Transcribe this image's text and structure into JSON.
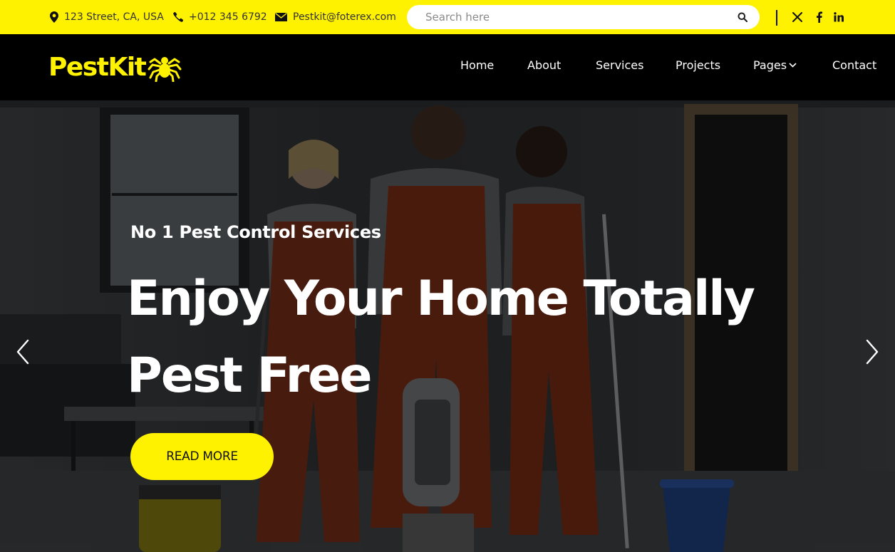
{
  "topbar": {
    "address": "123 Street, CA, USA",
    "phone": "+012 345 6792",
    "email": "Pestkit@foterex.com",
    "search_placeholder": "Search here",
    "social": [
      "x-icon",
      "facebook-icon",
      "linkedin-icon"
    ]
  },
  "brand": {
    "name": "PestKit",
    "accent_color": "#FFF200"
  },
  "nav": {
    "items": [
      {
        "label": "Home"
      },
      {
        "label": "About"
      },
      {
        "label": "Services"
      },
      {
        "label": "Projects"
      },
      {
        "label": "Pages"
      },
      {
        "label": "Contact"
      }
    ]
  },
  "hero": {
    "subtitle": "No 1 Pest Control Services",
    "title_line1": "Enjoy Your Home Totally",
    "title_line2": "Pest Free",
    "button_label": "READ MORE"
  }
}
